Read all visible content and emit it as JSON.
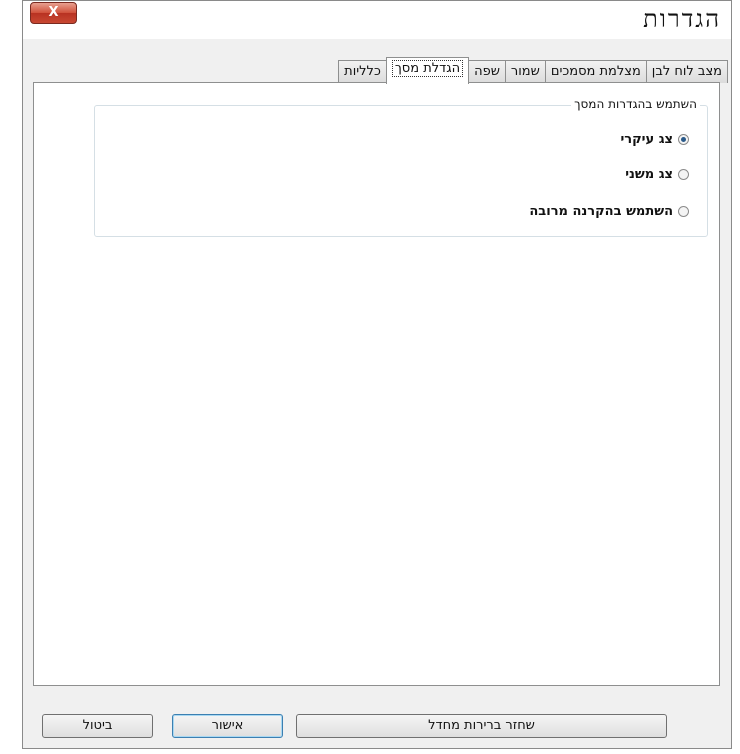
{
  "window": {
    "title": "הגדרות",
    "close_label": "X"
  },
  "tabs": [
    {
      "label": "כלליות",
      "active": false
    },
    {
      "label": "הגדלת מסך",
      "active": true
    },
    {
      "label": "שפה",
      "active": false
    },
    {
      "label": "שמור",
      "active": false
    },
    {
      "label": "מצלמת מסמכים",
      "active": false
    },
    {
      "label": "מצב לוח לבן",
      "active": false
    }
  ],
  "screen_settings": {
    "group_title": "השתמש בהגדרות המסך",
    "options": [
      {
        "label": "צג עיקרי",
        "checked": true
      },
      {
        "label": "צג משני",
        "checked": false
      },
      {
        "label": "השתמש בהקרנה מרובה",
        "checked": false
      }
    ]
  },
  "buttons": {
    "restore_defaults": "שחזר ברירות מחדל",
    "ok": "אישור",
    "cancel": "ביטול"
  }
}
